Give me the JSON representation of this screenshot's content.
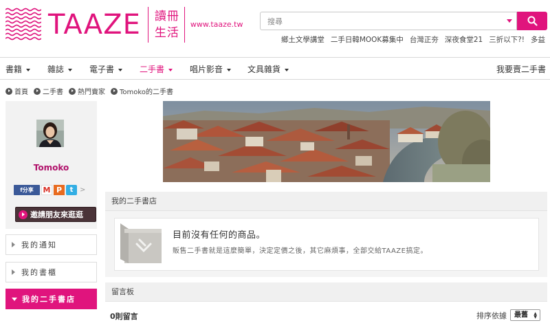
{
  "brand": {
    "logo_text": "TAAZE",
    "logo_cn": "讀冊生活",
    "logo_url": "www.taaze.tw",
    "accent_color": "#e0147d"
  },
  "search": {
    "placeholder": "搜尋"
  },
  "quick_links": [
    "鄉土文學講堂",
    "二手日韓MOOK募集中",
    "台灣正夯",
    "深夜食堂21",
    "三折以下?!",
    "多益"
  ],
  "nav": {
    "items": [
      {
        "label": "書籍"
      },
      {
        "label": "雜誌"
      },
      {
        "label": "電子書"
      },
      {
        "label": "二手書",
        "active": true
      },
      {
        "label": "唱片影音"
      },
      {
        "label": "文具雜貨"
      }
    ],
    "right_link": "我要賣二手書"
  },
  "breadcrumb": [
    "首頁",
    "二手書",
    "熱門賣家",
    "Tomoko的二手書"
  ],
  "profile": {
    "name": "Tomoko",
    "share": {
      "facebook": "f分享",
      "gmail": "M",
      "plurk": "P",
      "twitter": "t",
      "more": ">"
    },
    "invite_label": "邀請朋友來逛逛"
  },
  "side_menu": [
    {
      "label": "我的通知"
    },
    {
      "label": "我的書櫃"
    },
    {
      "label": "我的二手書店",
      "active": true
    }
  ],
  "shop_panel": {
    "title": "我的二手書店",
    "empty_title": "目前沒有任何的商品。",
    "empty_desc": "販售二手書就是這麼簡單，決定定價之後，其它麻煩事，全部交給TAAZE搞定。"
  },
  "comments": {
    "title": "留言板",
    "count_label": "0則留言",
    "sort_label": "排序依據",
    "sort_value": "最舊"
  }
}
